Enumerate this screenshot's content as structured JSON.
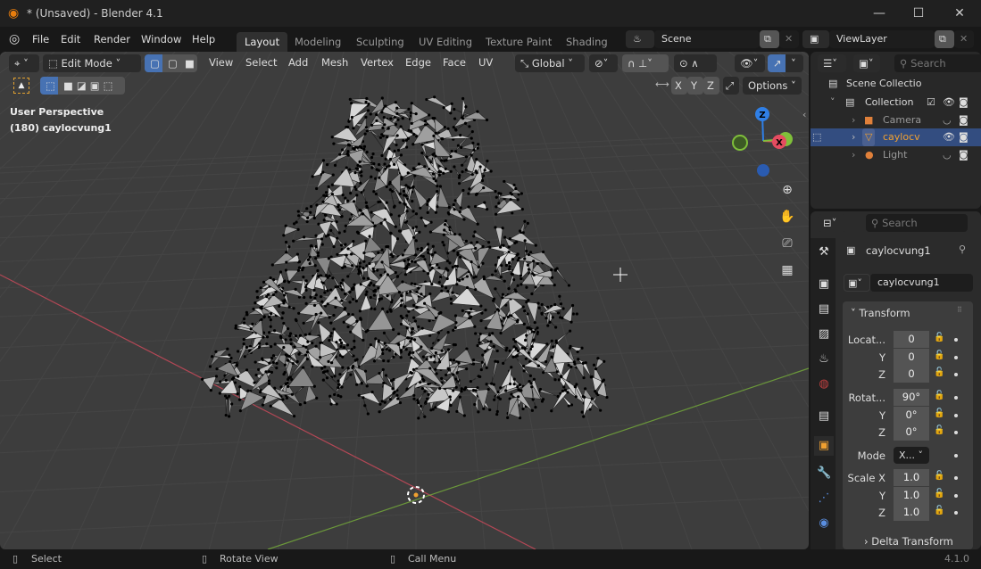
{
  "window": {
    "title": "* (Unsaved) - Blender 4.1",
    "minimize": "—",
    "maximize": "☐",
    "close": "✕"
  },
  "menu": [
    "File",
    "Edit",
    "Render",
    "Window",
    "Help"
  ],
  "workspaces": [
    "Layout",
    "Modeling",
    "Sculpting",
    "UV Editing",
    "Texture Paint",
    "Shading"
  ],
  "scene": {
    "name": "Scene",
    "view_layer": "ViewLayer"
  },
  "viewport_header": {
    "mode": "Edit Mode",
    "menus": [
      "View",
      "Select",
      "Add",
      "Mesh",
      "Vertex",
      "Edge",
      "Face",
      "UV"
    ],
    "orientation": "Global",
    "options": "Options",
    "axes": [
      "X",
      "Y",
      "Z"
    ]
  },
  "viewport": {
    "perspective": "User Perspective",
    "object_info": "(180) caylocvung1",
    "gizmo": {
      "z": "Z",
      "x": "X",
      "y": "Y"
    }
  },
  "outliner": {
    "search_placeholder": "Search",
    "items": [
      {
        "label": "Scene Collectio"
      },
      {
        "label": "Collection"
      },
      {
        "label": "Camera"
      },
      {
        "label": "caylocv",
        "selected": true
      },
      {
        "label": "Light"
      }
    ]
  },
  "properties": {
    "search_placeholder": "Search",
    "object_name": "caylocvung1",
    "data_name": "caylocvung1",
    "panel": "Transform",
    "location_label": "Locat...",
    "rotation_label": "Rotat...",
    "mode_label": "Mode",
    "mode_value": "X...",
    "scale_label": "Scale X",
    "y": "Y",
    "z": "Z",
    "location": [
      "0",
      "0",
      "0"
    ],
    "rotation": [
      "90°",
      "0°",
      "0°"
    ],
    "scale": [
      "1.0",
      "1.0",
      "1.0"
    ],
    "delta": "Delta Transform"
  },
  "status": {
    "select": "Select",
    "rotate": "Rotate View",
    "call_menu": "Call Menu",
    "version": "4.1.0"
  },
  "colors": {
    "accent": "#4772b3",
    "selected_object": "#f0a030",
    "x_axis": "#e54c60",
    "y_axis": "#7fbf3a",
    "z_axis": "#2f7fe6"
  }
}
